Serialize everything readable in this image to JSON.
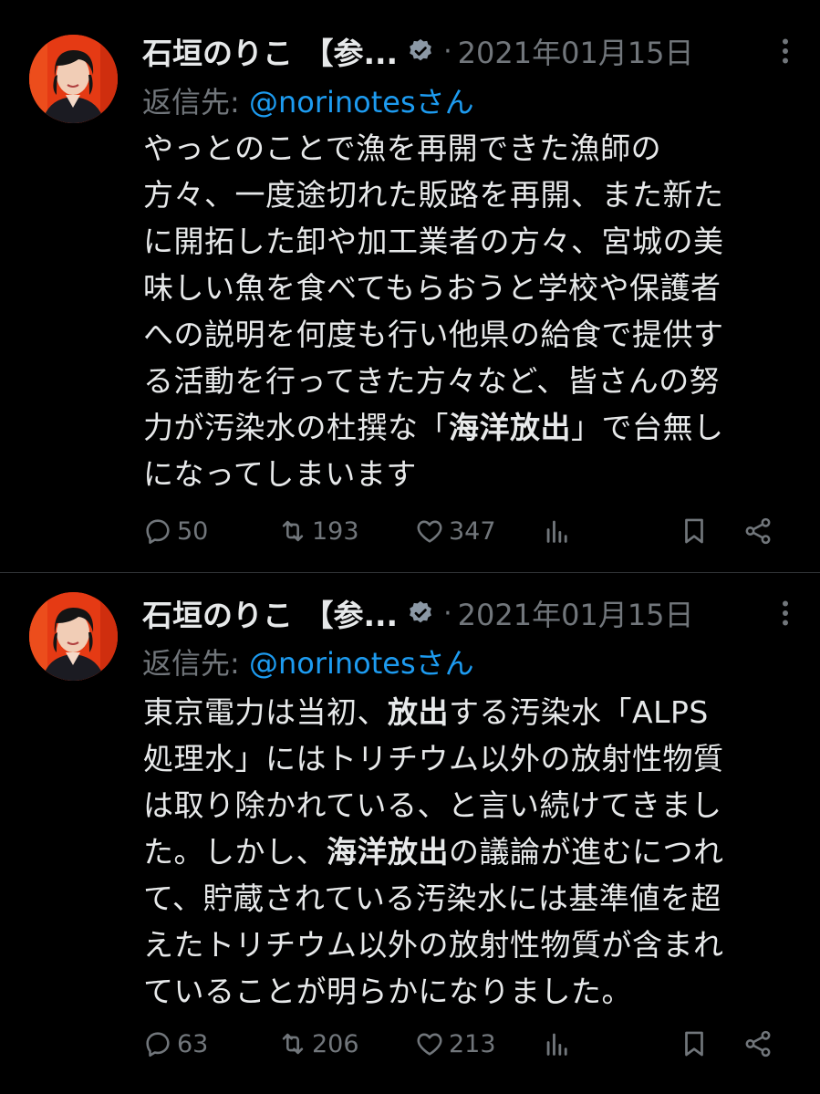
{
  "colors": {
    "background": "#000000",
    "text": "#e7e9ea",
    "secondary": "#71767b",
    "link": "#1d9bf0",
    "divider": "#2f3336",
    "avatar_bg": "#e8320f"
  },
  "tweets": [
    {
      "author": "石垣のりこ 【参...",
      "separator": "·",
      "date": "2021年01月15日",
      "reply_prefix": "返信先: ",
      "reply_handle": "@norinotesさん",
      "body_lines": [
        "やっとのことで漁を再開できた漁師の",
        "方々、一度途切れた販路を再開、また新た",
        "に開拓した卸や加工業者の方々、宮城の美",
        "味しい魚を食べてもらおうと学校や保護者",
        "への説明を何度も行い他県の給食で提供す",
        "る活動を行ってきた方々など、皆さんの努",
        [
          "力が汚染水の杜撰な「",
          "海洋放出",
          "」で台無し"
        ],
        "になってしまいます"
      ],
      "replies": "50",
      "retweets": "193",
      "likes": "347",
      "icons": [
        "reply-icon",
        "retweet-icon",
        "like-icon",
        "views-icon",
        "bookmark-icon",
        "share-icon",
        "more-icon",
        "verified-icon"
      ]
    },
    {
      "author": "石垣のりこ 【参...",
      "separator": "·",
      "date": "2021年01月15日",
      "reply_prefix": "返信先: ",
      "reply_handle": "@norinotesさん",
      "body_lines": [
        [
          "東京電力は当初、",
          "放出",
          "する汚染水「ALPS"
        ],
        "処理水」にはトリチウム以外の放射性物質",
        "は取り除かれている、と言い続けてきまし",
        [
          "た。しかし、",
          "海洋放出",
          "の議論が進むにつれ"
        ],
        "て、貯蔵されている汚染水には基準値を超",
        "えたトリチウム以外の放射性物質が含まれ",
        "ていることが明らかになりました。"
      ],
      "replies": "63",
      "retweets": "206",
      "likes": "213",
      "icons": [
        "reply-icon",
        "retweet-icon",
        "like-icon",
        "views-icon",
        "bookmark-icon",
        "share-icon",
        "more-icon",
        "verified-icon"
      ]
    }
  ]
}
